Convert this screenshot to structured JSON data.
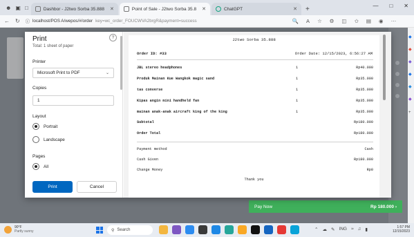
{
  "browser": {
    "tabs": [
      {
        "label": "Dashbor - J2two Sorba 35.888",
        "active": false
      },
      {
        "label": "Point of Sale - J2two Sorba 35.8",
        "active": true
      },
      {
        "label": "ChatGPT",
        "active": false
      }
    ],
    "url_host": "localhost/POS A/wepos/#/order",
    "url_rest": "key=wc_order_FOUCWVA2brgR&payment=success"
  },
  "print_dialog": {
    "title": "Print",
    "subtitle": "Total: 1 sheet of paper",
    "printer_label": "Printer",
    "printer_value": "Microsoft Print to PDF",
    "copies_label": "Copies",
    "copies_value": "1",
    "layout_label": "Layout",
    "layout_options": [
      "Portrait",
      "Landscape"
    ],
    "pages_label": "Pages",
    "pages_value": "All",
    "print_button": "Print",
    "cancel_button": "Cancel"
  },
  "receipt": {
    "shop_name": "J2two Sorba 35.888",
    "order_id": "Order ID: #33",
    "order_date": "Order Date: 12/15/2023, 6:56:27 AM",
    "items": [
      {
        "name": "JBL stereo headphones",
        "qty": "1",
        "price": "Rp40.000"
      },
      {
        "name": "Produk Mainan Kue Wangkok magic sand",
        "qty": "1",
        "price": "Rp35.000"
      },
      {
        "name": "tas converse",
        "qty": "1",
        "price": "Rp35.000"
      },
      {
        "name": "Kipas angin mini handheld fan",
        "qty": "1",
        "price": "Rp35.000"
      },
      {
        "name": "mainan anak-anak aircraft king of the king",
        "qty": "1",
        "price": "Rp35.000"
      }
    ],
    "subtotal_label": "Subtotal",
    "subtotal_value": "Rp180.000",
    "total_label": "Order Total",
    "total_value": "Rp180.000",
    "payment_method_label": "Payment method",
    "payment_method_value": "Cash",
    "cash_given_label": "Cash Given",
    "cash_given_value": "Rp180.000",
    "change_label": "Change Money",
    "change_value": "Rp0",
    "thanks": "Thank you"
  },
  "background_page": {
    "pay_now_label": "Pay Now",
    "pay_now_amount": "Rp 180.000"
  },
  "taskbar": {
    "weather_temp": "90°F",
    "weather_desc": "Partly sunny",
    "search_label": "Search",
    "lang": "ING",
    "time": "1:57 PM",
    "date": "12/15/2023"
  },
  "colors": {
    "print_button": "#0067c0",
    "pay_now_bar": "#3fb05b"
  }
}
